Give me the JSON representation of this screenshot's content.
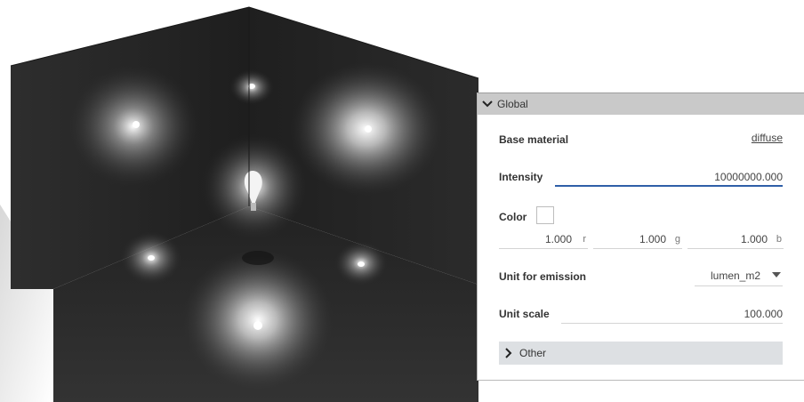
{
  "panel": {
    "section_title": "Global",
    "base_material": {
      "label": "Base material",
      "value": "diffuse"
    },
    "intensity": {
      "label": "Intensity",
      "value": "10000000.000"
    },
    "color": {
      "label": "Color",
      "swatch_color": "#ffffff",
      "r": {
        "value": "1.000",
        "channel": "r"
      },
      "g": {
        "value": "1.000",
        "channel": "g"
      },
      "b": {
        "value": "1.000",
        "channel": "b"
      }
    },
    "unit_for_emission": {
      "label": "Unit for emission",
      "value": "lumen_m2"
    },
    "unit_scale": {
      "label": "Unit scale",
      "value": "100.000"
    },
    "other_section_title": "Other"
  },
  "colors": {
    "accent": "#2f5fa8",
    "panel_header_bg": "#c9c9c9",
    "sub_header_bg": "#dde0e3"
  }
}
